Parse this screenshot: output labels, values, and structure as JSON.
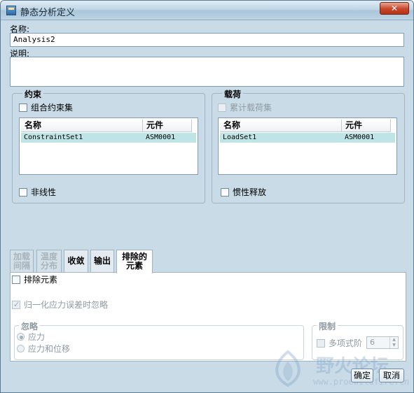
{
  "window": {
    "title": "静态分析定义",
    "close_glyph": "✕"
  },
  "name_field": {
    "label": "名称:",
    "value": "Analysis2"
  },
  "description_field": {
    "label": "说明:",
    "value": ""
  },
  "constraints": {
    "title": "约束",
    "combine_label": "组合约束集",
    "columns": [
      "名称",
      "元件"
    ],
    "rows": [
      {
        "name": "ConstraintSet1",
        "component": "ASM0001"
      }
    ],
    "nonlinear_label": "非线性"
  },
  "loads": {
    "title": "载荷",
    "cumulative_label": "累计载荷集",
    "columns": [
      "名称",
      "元件"
    ],
    "rows": [
      {
        "name": "LoadSet1",
        "component": "ASM0001"
      }
    ],
    "inertia_label": "惯性释放"
  },
  "tabs": [
    {
      "line1": "加载",
      "line2": "间隔",
      "state": "disabled"
    },
    {
      "line1": "温度",
      "line2": "分布",
      "state": "disabled"
    },
    {
      "line1": "收敛",
      "line2": "",
      "state": "normal"
    },
    {
      "line1": "输出",
      "line2": "",
      "state": "normal"
    },
    {
      "line1": "排除的",
      "line2": "元素",
      "state": "active"
    }
  ],
  "exclude_panel": {
    "exclude_elements_label": "排除元素",
    "ignore_norm_label": "归一化应力误差时忽略",
    "ignore_group": {
      "title": "忽略",
      "options": [
        "应力",
        "应力和位移"
      ],
      "selected": "应力"
    },
    "limit_group": {
      "title": "限制",
      "polynomial_label": "多项式阶",
      "polynomial_value": "6"
    }
  },
  "buttons": {
    "ok": "确定",
    "cancel": "取消"
  },
  "watermark": {
    "text": "野火论坛",
    "url": "www.proewildfire.cn"
  },
  "colors": {
    "window_bg": "#c9dbe6",
    "selection_bg": "#bfe4e6",
    "close_red": "#c8442a"
  }
}
